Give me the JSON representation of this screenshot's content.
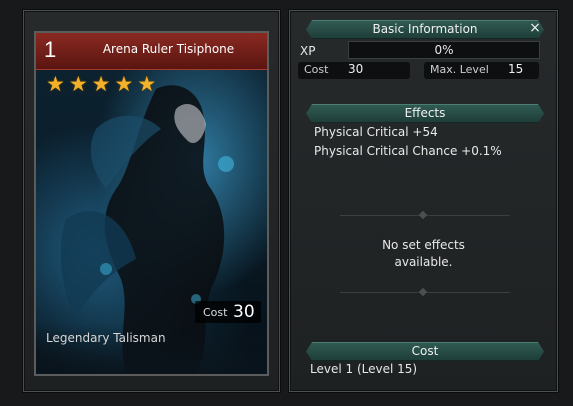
{
  "card": {
    "level": "1",
    "name": "Arena Ruler Tisiphone",
    "stars": [
      "★",
      "★",
      "★",
      "★",
      "★"
    ],
    "cost_label": "Cost",
    "cost_value": "30",
    "rarity": "Legendary Talisman",
    "star_color": "#f4b22a",
    "header_color": "#7a2018"
  },
  "info": {
    "title": "Basic Information",
    "close_icon": "×",
    "xp_label": "XP",
    "xp_value": "0%",
    "xp_fraction": 0,
    "cost_label": "Cost",
    "cost_value": "30",
    "max_level_label": "Max. Level",
    "max_level_value": "15"
  },
  "effects": {
    "title": "Effects",
    "lines": [
      "Physical Critical +54",
      "Physical Critical Chance +0.1%"
    ],
    "set_effects_line1": "No set effects",
    "set_effects_line2": "available."
  },
  "cost_section": {
    "title": "Cost",
    "value": "Level 1 (Level 15)"
  },
  "colors": {
    "section_header": "#2a5048",
    "background": "#17191a"
  }
}
